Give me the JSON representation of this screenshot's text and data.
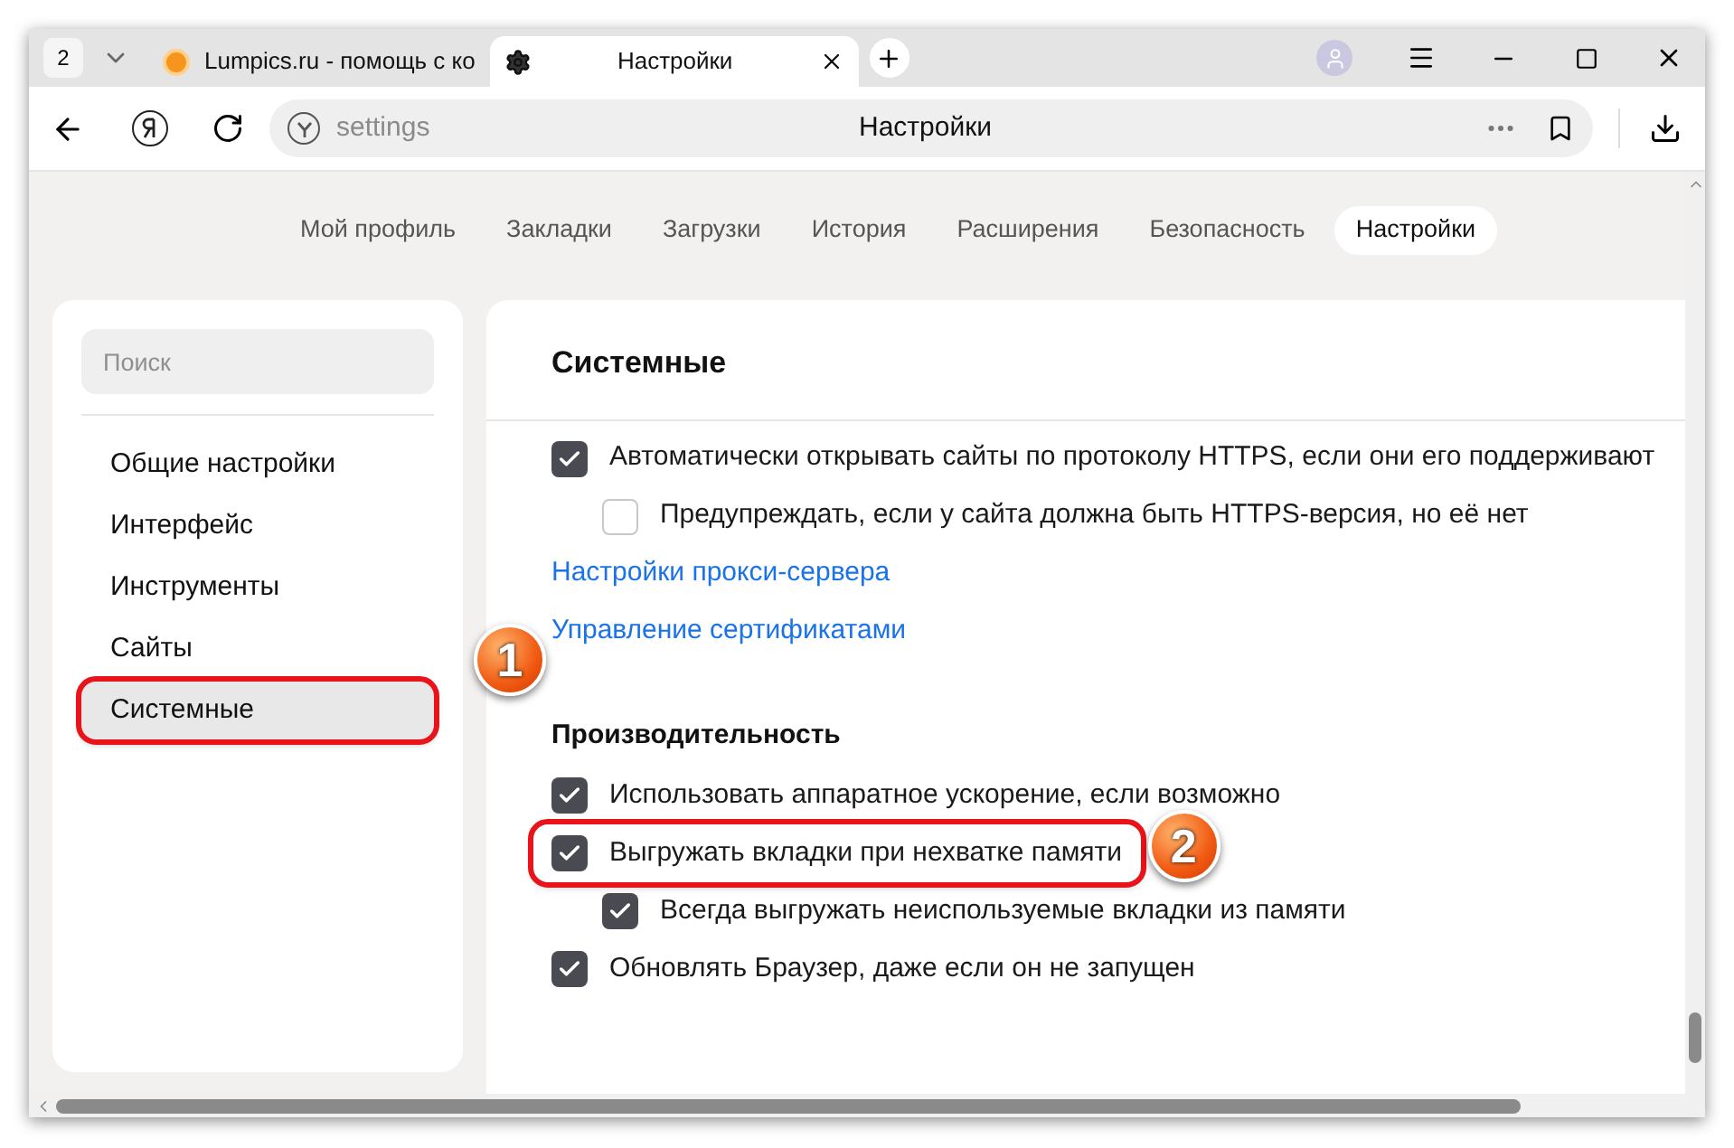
{
  "tab_count": "2",
  "tabs": [
    {
      "title": "Lumpics.ru - помощь с ко",
      "selected": false,
      "kind": "site"
    },
    {
      "title": "Настройки",
      "selected": true,
      "kind": "settings"
    }
  ],
  "address_bar": {
    "value": "settings",
    "page_title": "Настройки"
  },
  "nav_tabs": [
    {
      "label": "Мой профиль",
      "selected": false
    },
    {
      "label": "Закладки",
      "selected": false
    },
    {
      "label": "Загрузки",
      "selected": false
    },
    {
      "label": "История",
      "selected": false
    },
    {
      "label": "Расширения",
      "selected": false
    },
    {
      "label": "Безопасность",
      "selected": false
    },
    {
      "label": "Настройки",
      "selected": true
    }
  ],
  "sidebar": {
    "search": {
      "placeholder": "Поиск"
    },
    "items": [
      {
        "label": "Общие настройки",
        "selected": false,
        "highlighted": false
      },
      {
        "label": "Интерфейс",
        "selected": false,
        "highlighted": false
      },
      {
        "label": "Инструменты",
        "selected": false,
        "highlighted": false
      },
      {
        "label": "Сайты",
        "selected": false,
        "highlighted": false
      },
      {
        "label": "Системные",
        "selected": true,
        "highlighted": true,
        "callout": "1"
      }
    ]
  },
  "content": {
    "title": "Системные",
    "sections": [
      {
        "items": [
          {
            "kind": "checkbox",
            "label": "Автоматически открывать сайты по протоколу HTTPS, если они его поддерживают",
            "checked": true,
            "highlighted": false,
            "children": [
              {
                "kind": "checkbox",
                "label": "Предупреждать, если у сайта должна быть HTTPS-версия, но её нет",
                "checked": false,
                "highlighted": false
              }
            ]
          },
          {
            "kind": "link",
            "label": "Настройки прокси-сервера"
          },
          {
            "kind": "link",
            "label": "Управление сертификатами"
          }
        ]
      },
      {
        "heading": "Производительность",
        "items": [
          {
            "kind": "checkbox",
            "label": "Использовать аппаратное ускорение, если возможно",
            "checked": true,
            "highlighted": false
          },
          {
            "kind": "checkbox",
            "label": "Выгружать вкладки при нехватке памяти",
            "checked": true,
            "highlighted": true,
            "callout": "2",
            "children": [
              {
                "kind": "checkbox",
                "label": "Всегда выгружать неиспользуемые вкладки из памяти",
                "checked": true,
                "highlighted": false
              }
            ]
          },
          {
            "kind": "checkbox",
            "label": "Обновлять Браузер, даже если он не запущен",
            "checked": true,
            "highlighted": false
          }
        ]
      }
    ]
  }
}
